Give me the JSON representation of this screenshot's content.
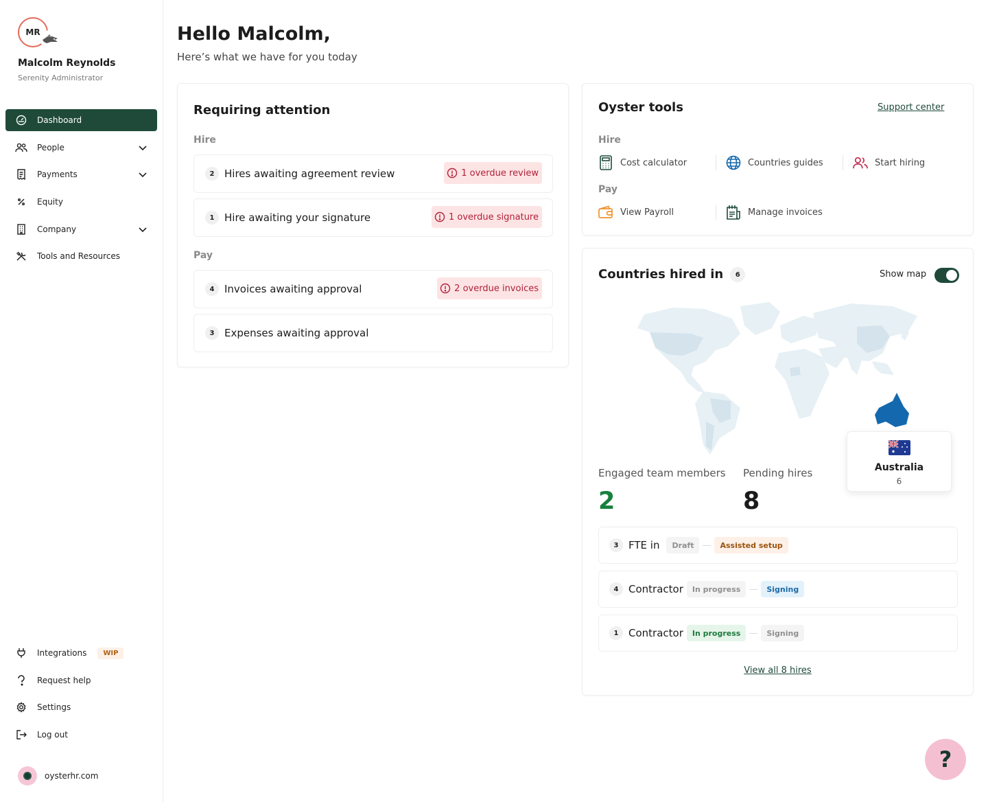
{
  "sidebar": {
    "initials": "MR",
    "user_name": "Malcolm Reynolds",
    "user_role": "Serenity Administrator",
    "nav": [
      {
        "label": "Dashboard",
        "icon": "gauge-icon",
        "active": true
      },
      {
        "label": "People",
        "icon": "people-icon",
        "expandable": true
      },
      {
        "label": "Payments",
        "icon": "receipt-icon",
        "expandable": true
      },
      {
        "label": "Equity",
        "icon": "percent-icon"
      },
      {
        "label": "Company",
        "icon": "building-icon",
        "expandable": true
      },
      {
        "label": "Tools and Resources",
        "icon": "tools-icon"
      }
    ],
    "bottom_nav": [
      {
        "label": "Integrations",
        "icon": "plug-icon",
        "badge": "WIP"
      },
      {
        "label": "Request help",
        "icon": "help-icon"
      },
      {
        "label": "Settings",
        "icon": "gear-icon"
      },
      {
        "label": "Log out",
        "icon": "logout-icon"
      }
    ],
    "site": "oysterhr.com"
  },
  "header": {
    "title": "Hello Malcolm,",
    "subtitle": "Here’s what we have for you today"
  },
  "attention": {
    "title": "Requiring attention",
    "hire_label": "Hire",
    "pay_label": "Pay",
    "items": [
      {
        "count": "2",
        "label": "Hires awaiting agreement review",
        "overdue": "1 overdue review"
      },
      {
        "count": "1",
        "label": "Hire awaiting your signature",
        "overdue": "1 overdue signature"
      },
      {
        "count": "4",
        "label": "Invoices awaiting approval",
        "overdue": "2 overdue invoices"
      },
      {
        "count": "3",
        "label": "Expenses awaiting approval",
        "overdue": ""
      }
    ]
  },
  "tools": {
    "title": "Oyster tools",
    "support_link": "Support center",
    "hire_label": "Hire",
    "pay_label": "Pay",
    "hire_tools": [
      {
        "label": "Cost calculator",
        "icon": "calculator-icon"
      },
      {
        "label": "Countries guides",
        "icon": "globe-icon"
      },
      {
        "label": "Start hiring",
        "icon": "users-icon"
      }
    ],
    "pay_tools": [
      {
        "label": "View Payroll",
        "icon": "wallet-icon"
      },
      {
        "label": "Manage invoices",
        "icon": "invoice-icon"
      }
    ]
  },
  "countries": {
    "title": "Countries hired in",
    "count": "6",
    "show_map_label": "Show map",
    "show_map_on": true,
    "highlight_country": "Australia",
    "highlight_value": "6",
    "stats": {
      "engaged_label": "Engaged team members",
      "engaged_value": "2",
      "pending_label": "Pending hires",
      "pending_value": "8"
    },
    "hires": [
      {
        "count": "3",
        "label": "FTE in",
        "tags": [
          "Draft",
          "Assisted setup"
        ]
      },
      {
        "count": "4",
        "label": "Contractor",
        "tags": [
          "In progress",
          "Signing"
        ]
      },
      {
        "count": "1",
        "label": "Contractor",
        "tags": [
          "In progress",
          "Signing"
        ]
      }
    ],
    "view_all": "View all 8 hires"
  },
  "help_button": "?",
  "colors": {
    "brand_green": "#1f4a3a",
    "overdue_red": "#b0203a",
    "stat_green": "#16803c",
    "map_highlight": "#1468ad",
    "help_pink": "#f5bfd2"
  }
}
